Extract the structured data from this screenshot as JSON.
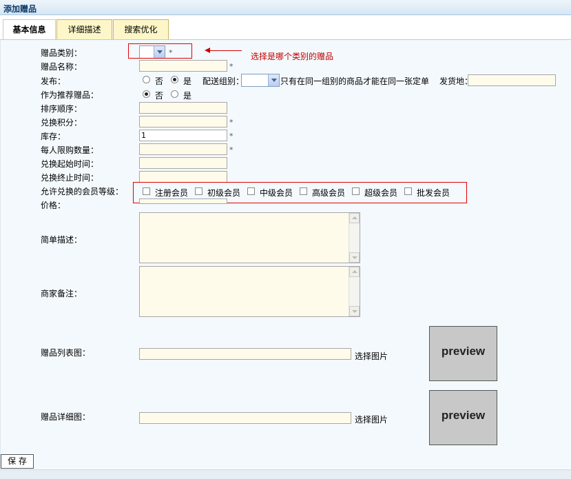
{
  "window": {
    "title": "添加赠品"
  },
  "tabs": [
    {
      "label": "基本信息",
      "active": true
    },
    {
      "label": "详细描述",
      "active": false
    },
    {
      "label": "搜索优化",
      "active": false
    }
  ],
  "form": {
    "category_label": "赠品类别：",
    "category_value": "",
    "name_label": "赠品名称：",
    "publish_label": "发布：",
    "publish_no": "否",
    "publish_yes": "是",
    "publish_selected": "是",
    "delivery_group_label": "配送组别：",
    "delivery_group_value": "",
    "delivery_group_hint": "只有在同一组别的商品才能在同一张定单",
    "ship_from_label": "发货地：",
    "ship_from_value": "",
    "recommend_label": "作为推荐赠品：",
    "recommend_no": "否",
    "recommend_yes": "是",
    "recommend_selected": "否",
    "sort_label": "排序顺序：",
    "points_label": "兑换积分：",
    "stock_label": "库存：",
    "stock_value": "1",
    "limit_label": "每人限购数量：",
    "start_label": "兑换起始时间：",
    "end_label": "兑换终止时间：",
    "levels_label": "允许兑换的会员等级：",
    "levels": [
      "注册会员",
      "初级会员",
      "中级会员",
      "高级会员",
      "超级会员",
      "批发会员"
    ],
    "price_label": "价格：",
    "desc_label": "简单描述：",
    "memo_label": "商家备注：",
    "list_img_label": "赠品列表图：",
    "list_img_button": "选择图片",
    "detail_img_label": "赠品详细图：",
    "detail_img_button": "选择图片",
    "required_mark": "*"
  },
  "annotation": {
    "text": "选择是哪个类别的赠品",
    "color": "#c00000"
  },
  "preview": {
    "text": "preview"
  },
  "footer": {
    "save_label": "保 存"
  },
  "colors": {
    "title_text": "#0b3a6b",
    "input_bg": "#fffbea",
    "panel_bg": "#f4f9fd",
    "tab_bg": "#fdf6c8",
    "annotation_red": "#e00000"
  }
}
